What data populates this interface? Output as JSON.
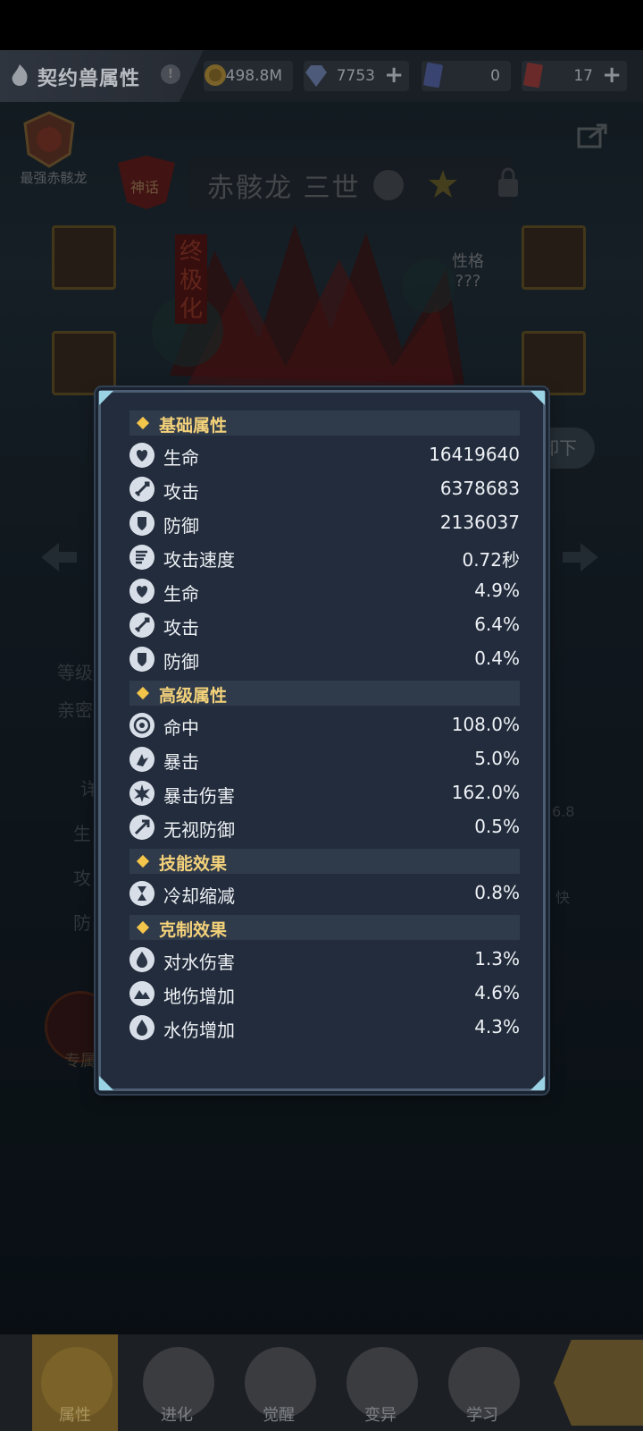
{
  "topbar": {
    "title": "契约兽属性",
    "title_icon": "flame-fist-icon",
    "info_icon_text": "!",
    "resources": [
      {
        "icon": "gold-coin-icon",
        "value": "498.8M",
        "has_plus": false
      },
      {
        "icon": "diamond-icon",
        "value": "7753",
        "has_plus": true
      },
      {
        "icon": "blue-card-icon",
        "value": "0",
        "has_plus": false
      },
      {
        "icon": "red-card-icon",
        "value": "17",
        "has_plus": true
      }
    ]
  },
  "background": {
    "badge_label": "最强赤骸龙",
    "hero_name": "赤骸龙 三世",
    "tag_text": "神话",
    "evolution_text": "终极化",
    "personality_line1": "性格",
    "personality_line2": "???",
    "unload_label": "卸下",
    "level_label": "等级",
    "intimacy_label": "亲密",
    "detail_label": "详",
    "life_label": "生",
    "attack_label": "攻",
    "defense_label": "防",
    "right_value": "6.8",
    "speed_label": "快",
    "exclusive_label": "专属"
  },
  "popup": {
    "sections": [
      {
        "title": "基础属性",
        "rows": [
          {
            "icon": "heart-shield-icon",
            "name": "生命",
            "value": "16419640"
          },
          {
            "icon": "sword-icon",
            "name": "攻击",
            "value": "6378683"
          },
          {
            "icon": "shield-icon",
            "name": "防御",
            "value": "2136037"
          },
          {
            "icon": "speed-wing-icon",
            "name": "攻击速度",
            "value": "0.72秒"
          },
          {
            "icon": "heart-shield-icon",
            "name": "生命",
            "value": "4.9%"
          },
          {
            "icon": "sword-icon",
            "name": "攻击",
            "value": "6.4%"
          },
          {
            "icon": "shield-icon",
            "name": "防御",
            "value": "0.4%"
          }
        ]
      },
      {
        "title": "高级属性",
        "rows": [
          {
            "icon": "target-icon",
            "name": "命中",
            "value": "108.0%"
          },
          {
            "icon": "critical-icon",
            "name": "暴击",
            "value": "5.0%"
          },
          {
            "icon": "burst-icon",
            "name": "暴击伤害",
            "value": "162.0%"
          },
          {
            "icon": "pierce-icon",
            "name": "无视防御",
            "value": "0.5%"
          }
        ]
      },
      {
        "title": "技能效果",
        "rows": [
          {
            "icon": "hourglass-icon",
            "name": "冷却缩减",
            "value": "0.8%"
          }
        ]
      },
      {
        "title": "克制效果",
        "rows": [
          {
            "icon": "water-drop-icon",
            "name": "对水伤害",
            "value": "1.3%"
          },
          {
            "icon": "earth-mountain-icon",
            "name": "地伤增加",
            "value": "4.6%"
          },
          {
            "icon": "water-drop-icon",
            "name": "水伤增加",
            "value": "4.3%"
          }
        ]
      }
    ]
  },
  "tabbar": {
    "tabs": [
      {
        "label": "属性",
        "icon": "paw-icon",
        "active": true
      },
      {
        "label": "进化",
        "icon": "arrow-up-icon",
        "active": false
      },
      {
        "label": "觉醒",
        "icon": "fox-mask-icon",
        "active": false
      },
      {
        "label": "变异",
        "icon": "swirl-icon",
        "active": false
      },
      {
        "label": "学习",
        "icon": "flame-icon",
        "active": false
      }
    ],
    "next_icon": "arrow-right-icon"
  },
  "colors": {
    "popup_bg": "#222c3c",
    "section_header_bg": "#2f3a4b",
    "section_title": "#f4d27a",
    "diamond": "#f3c54a",
    "value_text": "#eef1f5"
  }
}
